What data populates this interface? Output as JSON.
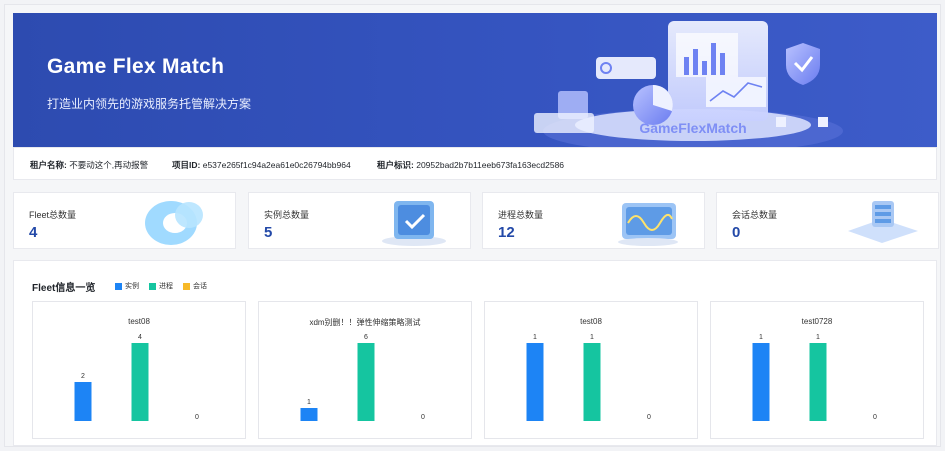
{
  "banner": {
    "title": "Game Flex Match",
    "subtitle": "打造业内领先的游戏服务托管解决方案",
    "illustration_text": "GameFlexMatch"
  },
  "info": {
    "tenant_name_key": "租户名称:",
    "tenant_name_val": "不要动这个,再动报警",
    "project_id_key": "项目ID:",
    "project_id_val": "e537e265f1c94a2ea61e0c26794bb964",
    "tenant_id_key": "租户标识:",
    "tenant_id_val": "20952bad2b7b11eeb673fa163ecd2586"
  },
  "stats": [
    {
      "label": "Fleet总数量",
      "value": "4"
    },
    {
      "label": "实例总数量",
      "value": "5"
    },
    {
      "label": "进程总数量",
      "value": "12"
    },
    {
      "label": "会话总数量",
      "value": "0"
    }
  ],
  "fleet_panel": {
    "title": "Fleet信息一览",
    "legend": [
      {
        "name": "实例",
        "color": "#1d84f5"
      },
      {
        "name": "进程",
        "color": "#15c5a0"
      },
      {
        "name": "会话",
        "color": "#f7b928"
      }
    ]
  },
  "chart_data": [
    {
      "type": "bar",
      "title": "test08",
      "categories": [
        "实例",
        "进程",
        "会话"
      ],
      "values": [
        2,
        4,
        0
      ],
      "ylim": [
        0,
        4
      ]
    },
    {
      "type": "bar",
      "title": "xdm别删！！弹性伸缩策略测试",
      "categories": [
        "实例",
        "进程",
        "会话"
      ],
      "values": [
        1,
        6,
        0
      ],
      "ylim": [
        0,
        6
      ]
    },
    {
      "type": "bar",
      "title": "test08",
      "categories": [
        "实例",
        "进程",
        "会话"
      ],
      "values": [
        1,
        1,
        0
      ],
      "ylim": [
        0,
        1
      ]
    },
    {
      "type": "bar",
      "title": "test0728",
      "categories": [
        "实例",
        "进程",
        "会话"
      ],
      "values": [
        1,
        1,
        0
      ],
      "ylim": [
        0,
        1
      ]
    }
  ]
}
